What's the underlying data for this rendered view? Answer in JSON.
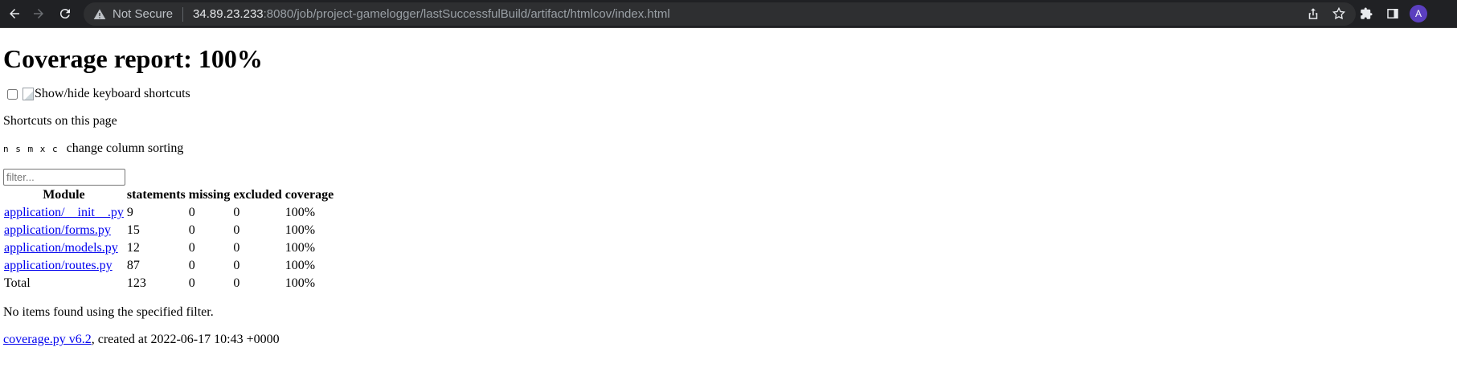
{
  "browser": {
    "not_secure": "Not Secure",
    "host": "34.89.23.233",
    "path": ":8080/job/project-gamelogger/lastSuccessfulBuild/artifact/htmlcov/index.html",
    "avatar_letter": "A"
  },
  "page": {
    "title": "Coverage report: 100%",
    "toggle_label": "Show/hide keyboard shortcuts",
    "shortcuts_heading": "Shortcuts on this page",
    "shortcut_keys": "n s m x c",
    "shortcut_desc": "change column sorting",
    "filter_placeholder": "filter...",
    "no_items": "No items found using the specified filter.",
    "footer_link": "coverage.py v6.2",
    "footer_text": ", created at 2022-06-17 10:43 +0000"
  },
  "table": {
    "headers": [
      "Module",
      "statements",
      "missing",
      "excluded",
      "coverage"
    ],
    "rows": [
      {
        "module": "application/__init__.py",
        "statements": "9",
        "missing": "0",
        "excluded": "0",
        "coverage": "100%"
      },
      {
        "module": "application/forms.py",
        "statements": "15",
        "missing": "0",
        "excluded": "0",
        "coverage": "100%"
      },
      {
        "module": "application/models.py",
        "statements": "12",
        "missing": "0",
        "excluded": "0",
        "coverage": "100%"
      },
      {
        "module": "application/routes.py",
        "statements": "87",
        "missing": "0",
        "excluded": "0",
        "coverage": "100%"
      }
    ],
    "total": {
      "module": "Total",
      "statements": "123",
      "missing": "0",
      "excluded": "0",
      "coverage": "100%"
    }
  }
}
